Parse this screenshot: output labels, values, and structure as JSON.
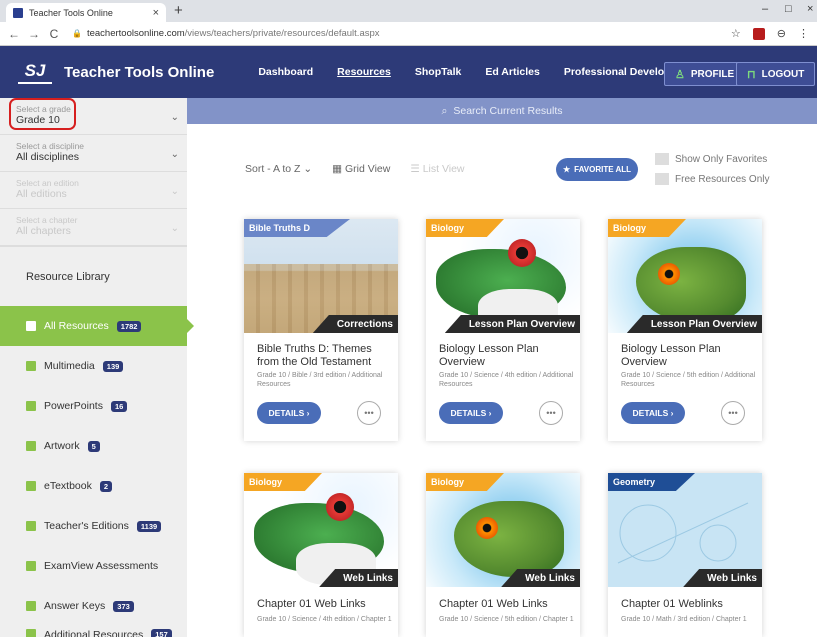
{
  "browser": {
    "tab_title": "Teacher Tools Online",
    "tab_close": "×",
    "new_tab": "+",
    "url_domain": "teachertoolsonline.com",
    "url_path": "/views/teachers/private/resources/default.aspx",
    "win_min": "–",
    "win_max": "□",
    "win_close": "×"
  },
  "header": {
    "logo_mark": "SJ",
    "logo_text": "Teacher Tools Online",
    "nav": [
      "Dashboard",
      "Resources",
      "ShopTalk",
      "Ed Articles",
      "Professional Development"
    ],
    "profile_label": "PROFILE",
    "logout_label": "LOGOUT"
  },
  "sidebar": {
    "grade": {
      "label": "Select a grade",
      "value": "Grade 10"
    },
    "discipline": {
      "label": "Select a discipline",
      "value": "All disciplines"
    },
    "edition": {
      "label": "Select an edition",
      "value": "All editions"
    },
    "chapter": {
      "label": "Select a chapter",
      "value": "All chapters"
    },
    "library_title": "Resource Library",
    "items": [
      {
        "label": "All Resources",
        "count": "1782"
      },
      {
        "label": "Multimedia",
        "count": "139"
      },
      {
        "label": "PowerPoints",
        "count": "16"
      },
      {
        "label": "Artwork",
        "count": "5"
      },
      {
        "label": "eTextbook",
        "count": "2"
      },
      {
        "label": "Teacher's Editions",
        "count": "1139"
      },
      {
        "label": "ExamView Assessments",
        "count": ""
      },
      {
        "label": "Answer Keys",
        "count": "373"
      },
      {
        "label": "Additional Resources",
        "count": "157"
      }
    ]
  },
  "main": {
    "search_placeholder": "Search Current Results",
    "sort_label": "Sort - A to Z",
    "grid_view": "Grid View",
    "list_view": "List View",
    "favorite_all": "FAVORITE ALL",
    "show_favorites": "Show Only Favorites",
    "free_only": "Free Resources Only",
    "details_label": "DETAILS ›",
    "more_label": "•••",
    "cards": [
      {
        "subject": "Bible Truths D",
        "subject_color": "#6a86c8",
        "type": "Corrections",
        "title": "Bible Truths D: Themes from the Old Testament",
        "meta": "Grade 10 / Bible / 3rd edition / Additional Resources"
      },
      {
        "subject": "Biology",
        "subject_color": "#f5a623",
        "type": "Lesson Plan Overview",
        "title": "Biology Lesson Plan Overview",
        "meta": "Grade 10 / Science / 4th edition / Additional Resources"
      },
      {
        "subject": "Biology",
        "subject_color": "#f5a623",
        "type": "Lesson Plan Overview",
        "title": "Biology Lesson Plan Overview",
        "meta": "Grade 10 / Science / 5th edition / Additional Resources"
      },
      {
        "subject": "Biology",
        "subject_color": "#f5a623",
        "type": "Web Links",
        "title": "Chapter 01 Web Links",
        "meta": "Grade 10 / Science / 4th edition / Chapter 1"
      },
      {
        "subject": "Biology",
        "subject_color": "#f5a623",
        "type": "Web Links",
        "title": "Chapter 01 Web Links",
        "meta": "Grade 10 / Science / 5th edition / Chapter 1"
      },
      {
        "subject": "Geometry",
        "subject_color": "#1f4e96",
        "type": "Web Links",
        "title": "Chapter 01 Weblinks",
        "meta": "Grade 10 / Math / 3rd edition / Chapter 1"
      }
    ]
  }
}
